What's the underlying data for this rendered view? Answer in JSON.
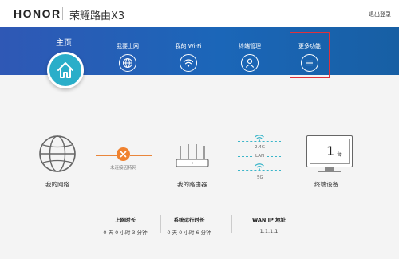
{
  "header": {
    "brand": "HONOR",
    "product": "荣耀路由X3",
    "logout": "退出登录"
  },
  "nav": {
    "home": {
      "label": "主页",
      "icon": "home-icon"
    },
    "items": [
      {
        "label": "我要上网",
        "icon": "globe-icon"
      },
      {
        "label": "我的 Wi-Fi",
        "icon": "wifi-icon"
      },
      {
        "label": "终端管理",
        "icon": "user-icon"
      },
      {
        "label": "更多功能",
        "icon": "menu-icon"
      }
    ]
  },
  "diagram": {
    "internet_label": "我的网络",
    "status_text": "未连接因特网",
    "router_label": "我的路由器",
    "bands": [
      "2.4G",
      "LAN",
      "5G"
    ],
    "devices_label": "终端设备",
    "device_count": "1",
    "device_unit": "台"
  },
  "stats": [
    {
      "title": "上网时长",
      "value": "0 天 0 小时 3 分钟"
    },
    {
      "title": "系统运行时长",
      "value": "0 天 0 小时 6 分钟"
    },
    {
      "title": "WAN IP 地址",
      "value": "1.1.1.1"
    }
  ],
  "colors": {
    "nav_band": "#1b66b8",
    "home_circle": "#2aaec9",
    "status_error": "#f0822f",
    "highlight_box": "#e0313b",
    "band_accent": "#3ab5c9"
  }
}
